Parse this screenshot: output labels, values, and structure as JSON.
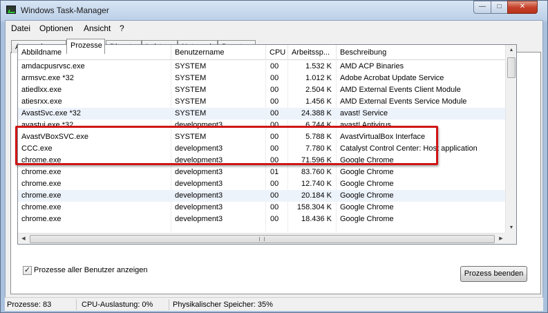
{
  "window": {
    "title": "Windows Task-Manager",
    "minimize_glyph": "—",
    "maximize_glyph": "□",
    "close_glyph": "✕"
  },
  "menu": [
    "Datei",
    "Optionen",
    "Ansicht",
    "?"
  ],
  "tabs": [
    {
      "label": "Anwendungen",
      "active": false
    },
    {
      "label": "Prozesse",
      "active": true
    },
    {
      "label": "Dienste",
      "active": false
    },
    {
      "label": "Leistung",
      "active": false
    },
    {
      "label": "Netzwerk",
      "active": false
    },
    {
      "label": "Benutzer",
      "active": false
    }
  ],
  "columns": {
    "name": "Abbildname",
    "user": "Benutzername",
    "cpu": "CPU",
    "mem": "Arbeitssp...",
    "desc": "Beschreibung"
  },
  "processes": [
    {
      "name": "amdacpusrvsc.exe",
      "user": "SYSTEM",
      "cpu": "00",
      "mem": "1.532 K",
      "desc": "AMD ACP Binaries"
    },
    {
      "name": "armsvc.exe *32",
      "user": "SYSTEM",
      "cpu": "00",
      "mem": "1.012 K",
      "desc": "Adobe Acrobat Update Service"
    },
    {
      "name": "atiedlxx.exe",
      "user": "SYSTEM",
      "cpu": "00",
      "mem": "2.504 K",
      "desc": "AMD External Events Client Module"
    },
    {
      "name": "atiesrxx.exe",
      "user": "SYSTEM",
      "cpu": "00",
      "mem": "1.456 K",
      "desc": "AMD External Events Service Module"
    },
    {
      "name": "AvastSvc.exe *32",
      "user": "SYSTEM",
      "cpu": "00",
      "mem": "24.388 K",
      "desc": "avast! Service"
    },
    {
      "name": "avastui.exe *32",
      "user": "development3",
      "cpu": "00",
      "mem": "6.744 K",
      "desc": "avast! Antivirus"
    },
    {
      "name": "AvastVBoxSVC.exe",
      "user": "SYSTEM",
      "cpu": "00",
      "mem": "5.788 K",
      "desc": "AvastVirtualBox Interface"
    },
    {
      "name": "CCC.exe",
      "user": "development3",
      "cpu": "00",
      "mem": "7.780 K",
      "desc": "Catalyst Control Center: Host application"
    },
    {
      "name": "chrome.exe",
      "user": "development3",
      "cpu": "00",
      "mem": "71.596 K",
      "desc": "Google Chrome"
    },
    {
      "name": "chrome.exe",
      "user": "development3",
      "cpu": "01",
      "mem": "83.760 K",
      "desc": "Google Chrome"
    },
    {
      "name": "chrome.exe",
      "user": "development3",
      "cpu": "00",
      "mem": "12.740 K",
      "desc": "Google Chrome"
    },
    {
      "name": "chrome.exe",
      "user": "development3",
      "cpu": "00",
      "mem": "20.184 K",
      "desc": "Google Chrome"
    },
    {
      "name": "chrome.exe",
      "user": "development3",
      "cpu": "00",
      "mem": "158.304 K",
      "desc": "Google Chrome"
    },
    {
      "name": "chrome.exe",
      "user": "development3",
      "cpu": "00",
      "mem": "18.436 K",
      "desc": "Google Chrome"
    }
  ],
  "show_all_users": {
    "label": "Prozesse aller Benutzer anzeigen",
    "checked": true
  },
  "end_process_label": "Prozess beenden",
  "status": {
    "processes": "Prozesse: 83",
    "cpu": "CPU-Auslastung: 0%",
    "memory": "Physikalischer Speicher: 35%"
  },
  "colors": {
    "highlight_border": "#d01515",
    "window_frame": "#b9cde6",
    "close_button": "#c6422b"
  }
}
